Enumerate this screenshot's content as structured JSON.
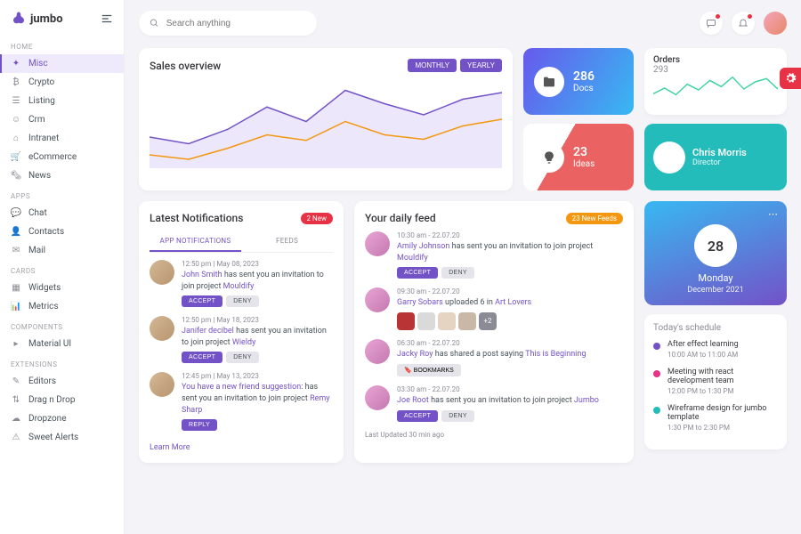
{
  "brand": {
    "name": "jumbo"
  },
  "search": {
    "placeholder": "Search anything"
  },
  "nav": {
    "groups": [
      {
        "heading": "HOME",
        "items": [
          {
            "label": "Misc",
            "icon": "✦",
            "active": true
          },
          {
            "label": "Crypto",
            "icon": "₿"
          },
          {
            "label": "Listing",
            "icon": "☰"
          },
          {
            "label": "Crm",
            "icon": "☺"
          },
          {
            "label": "Intranet",
            "icon": "⌂"
          },
          {
            "label": "eCommerce",
            "icon": "🛒"
          },
          {
            "label": "News",
            "icon": "🗞"
          }
        ]
      },
      {
        "heading": "APPS",
        "items": [
          {
            "label": "Chat",
            "icon": "💬"
          },
          {
            "label": "Contacts",
            "icon": "👤"
          },
          {
            "label": "Mail",
            "icon": "✉"
          }
        ]
      },
      {
        "heading": "CARDS",
        "items": [
          {
            "label": "Widgets",
            "icon": "▦"
          },
          {
            "label": "Metrics",
            "icon": "📊"
          }
        ]
      },
      {
        "heading": "COMPONENTS",
        "items": [
          {
            "label": "Material UI",
            "icon": "▸"
          }
        ]
      },
      {
        "heading": "EXTENSIONS",
        "items": [
          {
            "label": "Editors",
            "icon": "✎"
          },
          {
            "label": "Drag n Drop",
            "icon": "⇅"
          },
          {
            "label": "Dropzone",
            "icon": "☁"
          },
          {
            "label": "Sweet Alerts",
            "icon": "⚠"
          }
        ]
      }
    ]
  },
  "sales": {
    "title": "Sales overview",
    "monthly": "MONTHLY",
    "yearly": "YEARLY"
  },
  "chart_data": {
    "type": "line",
    "series": [
      {
        "name": "primary",
        "values": [
          28,
          22,
          35,
          55,
          42,
          70,
          58,
          48,
          62,
          68
        ]
      },
      {
        "name": "secondary",
        "values": [
          12,
          8,
          18,
          30,
          25,
          42,
          30,
          26,
          38,
          44
        ]
      }
    ],
    "x": [
      0,
      1,
      2,
      3,
      4,
      5,
      6,
      7,
      8,
      9
    ],
    "ylim": [
      0,
      80
    ]
  },
  "stats": {
    "docs": {
      "num": "286",
      "label": "Docs"
    },
    "ideas": {
      "num": "23",
      "label": "Ideas"
    }
  },
  "orders": {
    "title": "Orders",
    "num": "293"
  },
  "orders_chart": {
    "type": "line",
    "values": [
      20,
      32,
      18,
      40,
      28,
      48,
      35,
      55,
      30,
      45,
      52,
      30
    ],
    "ylim": [
      0,
      60
    ]
  },
  "person": {
    "name": "Chris Morris",
    "role": "Director"
  },
  "notifications": {
    "title": "Latest Notifications",
    "badge": "2 New",
    "tab1": "APP NOTIFICATIONS",
    "tab2": "FEEDS",
    "accept": "ACCEPT",
    "deny": "DENY",
    "reply": "REPLY",
    "learn": "Learn More",
    "items": [
      {
        "time": "12:50 pm | May 08, 2023",
        "who": "John Smith",
        "rest": " has sent you an invitation to join project ",
        "proj": "Mouldify"
      },
      {
        "time": "12:50 pm | May 18, 2023",
        "who": "Janifer decibel",
        "rest": " has sent you an invitation to join project ",
        "proj": "Wieldy"
      },
      {
        "time": "12:45 pm | May 13, 2023",
        "who": "You have a new friend suggestion:",
        "rest": " has sent you an invitation to join project ",
        "proj": "Remy Sharp"
      }
    ]
  },
  "feed": {
    "title": "Your daily feed",
    "badge": "23 New Feeds",
    "bookmarks": "BOOKMARKS",
    "footer": "Last Updated 30 min ago",
    "items": [
      {
        "time": "10:30 am - 22.07.20",
        "who": "Amily Johnson",
        "rest": " has sent you an invitation to join project ",
        "proj": "Mouldify",
        "type": "accept"
      },
      {
        "time": "09:30 am - 22.07.20",
        "who": "Garry Sobars",
        "rest": " uploaded 6 in ",
        "proj": "Art Lovers",
        "type": "thumbs"
      },
      {
        "time": "06:30 am - 22.07.20",
        "who": "Jacky Roy",
        "rest": " has shared a post saying ",
        "proj": "This is Beginning",
        "type": "bookmark"
      },
      {
        "time": "03:30 am - 22.07.20",
        "who": "Joe Root",
        "rest": " has sent you an invitation to join project ",
        "proj": "Jumbo",
        "type": "accept"
      }
    ]
  },
  "calendar": {
    "date": "28",
    "day": "Monday",
    "month": "December 2021"
  },
  "schedule": {
    "title": "Today's schedule",
    "items": [
      {
        "color": "#7352c7",
        "title": "After effect learning",
        "time": "10:00 AM to 11:00 AM"
      },
      {
        "color": "#e73186",
        "title": "Meeting with react development team",
        "time": "12:00 PM to 1:30 PM"
      },
      {
        "color": "#23bcba",
        "title": "Wireframe design for jumbo template",
        "time": "1:30 PM to 2:30 PM"
      }
    ]
  },
  "thumbs_more": "+2"
}
